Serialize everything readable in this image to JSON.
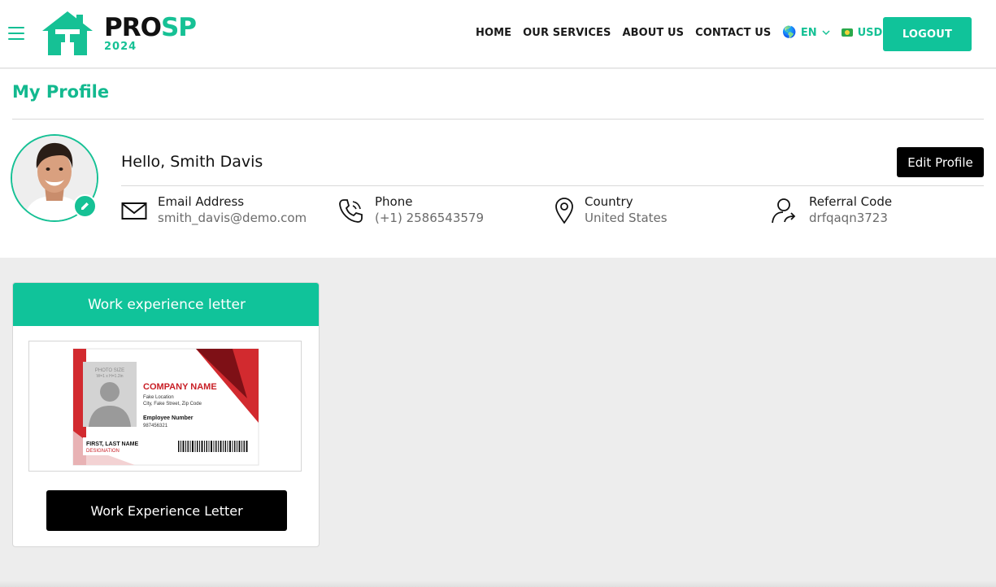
{
  "header": {
    "logo": {
      "text_a": "PRO",
      "text_b": "SP",
      "year": "2024"
    },
    "nav": [
      "HOME",
      "OUR SERVICES",
      "ABOUT US",
      "CONTACT US"
    ],
    "language": {
      "label": "EN",
      "icon": "globe-icon"
    },
    "currency": {
      "label": "USD",
      "icon": "flag-icon"
    },
    "logout_label": "LOGOUT"
  },
  "profile": {
    "title": "My Profile",
    "greeting": "Hello, Smith Davis",
    "edit_label": "Edit Profile",
    "fields": [
      {
        "label": "Email Address",
        "value": "smith_davis@demo.com",
        "icon": "envelope-icon"
      },
      {
        "label": "Phone",
        "value": "(+1) 2586543579",
        "icon": "phone-icon"
      },
      {
        "label": "Country",
        "value": "United States",
        "icon": "location-pin-icon"
      },
      {
        "label": "Referral Code",
        "value": "drfqaqn3723",
        "icon": "user-share-icon"
      }
    ]
  },
  "card": {
    "title": "Work experience letter",
    "button_label": "Work Experience Letter",
    "id_card": {
      "photo_size": "PHOTO SIZE",
      "photo_dims": "W=1 x H=1.2in",
      "company": "COMPANY NAME",
      "address1": "Fake Location",
      "address2": "City, Fake Street, Zip Code",
      "emp_label": "Employee Number",
      "emp_number": "987456321",
      "name": "FIRST, LAST NAME",
      "designation": "DESIGNATION"
    }
  },
  "colors": {
    "accent": "#10c39a",
    "dark": "#000000",
    "id_red": "#c81e25"
  }
}
